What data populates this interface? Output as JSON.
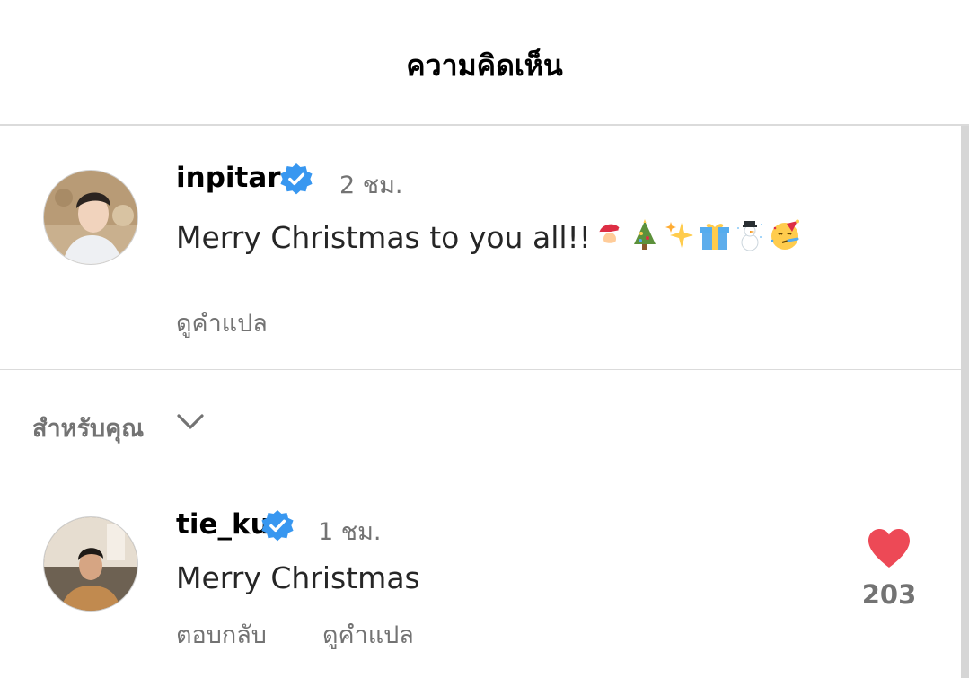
{
  "header": {
    "title": "ความคิดเห็น"
  },
  "caption": {
    "username": "inpitar",
    "verified": true,
    "time": "2 ชม.",
    "text": "Merry Christmas to you all!!",
    "emojis": [
      "santa-emoji",
      "christmas-tree-emoji",
      "sparkles-emoji",
      "gift-emoji",
      "snowman-emoji",
      "partying-face-emoji"
    ],
    "translate_label": "ดูคำแปล"
  },
  "section": {
    "label": "สำหรับคุณ",
    "icon": "chevron-down-icon"
  },
  "comments": [
    {
      "username": "tie_ku",
      "verified": true,
      "time": "1 ชม.",
      "text": "Merry Christmas",
      "reply_label": "ตอบกลับ",
      "translate_label": "ดูคำแปล",
      "likes": "203",
      "liked": true
    }
  ],
  "colors": {
    "verified": "#3897f0",
    "heart": "#ed4956",
    "muted": "#737373"
  }
}
